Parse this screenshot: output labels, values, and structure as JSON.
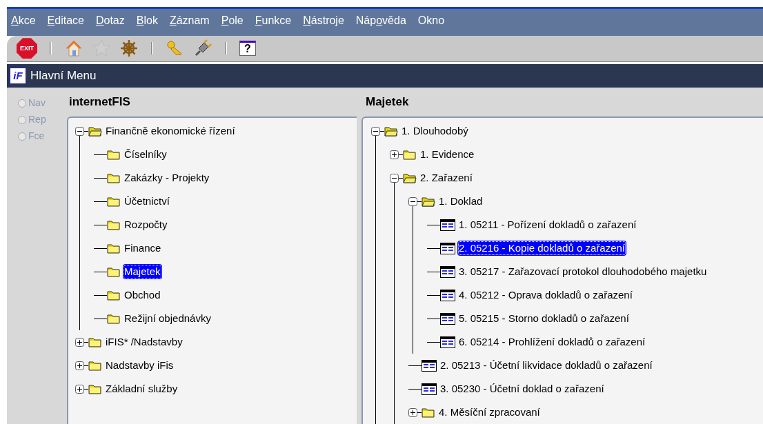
{
  "menu": [
    {
      "key": "A",
      "after": "kce"
    },
    {
      "key": "E",
      "after": "ditace"
    },
    {
      "key": "D",
      "after": "otaz"
    },
    {
      "key": "B",
      "after": "lok"
    },
    {
      "key": "Z",
      "after": "áznam"
    },
    {
      "key": "P",
      "after": "ole"
    },
    {
      "key": "F",
      "after": "unkce"
    },
    {
      "key": "N",
      "after": "ástroje"
    },
    {
      "before": "Náp",
      "key": "o",
      "after": "věda"
    },
    {
      "before": "Okno"
    }
  ],
  "toolbar": [
    {
      "kind": "exit",
      "text": "EXIT",
      "disabled": false
    },
    {
      "kind": "separator"
    },
    {
      "kind": "home",
      "disabled": false
    },
    {
      "kind": "star",
      "disabled": true
    },
    {
      "kind": "wheel",
      "disabled": false
    },
    {
      "kind": "separator"
    },
    {
      "kind": "key",
      "disabled": false
    },
    {
      "kind": "plug",
      "disabled": false
    },
    {
      "kind": "separator"
    },
    {
      "kind": "help",
      "text": "?",
      "disabled": false
    }
  ],
  "window": {
    "logo": "iF",
    "title": "Hlavní Menu"
  },
  "modes": [
    {
      "label": "Nav",
      "selected": false,
      "disabled": true
    },
    {
      "label": "Rep",
      "selected": false,
      "disabled": true
    },
    {
      "label": "Fce",
      "selected": false,
      "disabled": true
    }
  ],
  "left_tree": {
    "title": "internetFIS",
    "nodes": [
      {
        "label": "Finančně ekonomické řízení",
        "kind": "folder",
        "expanded": true,
        "selected": false,
        "children": [
          {
            "label": "Číselníky",
            "kind": "folder",
            "selected": false
          },
          {
            "label": "Zakázky - Projekty",
            "kind": "folder",
            "selected": false
          },
          {
            "label": "Účetnictví",
            "kind": "folder",
            "selected": false
          },
          {
            "label": "Rozpočty",
            "kind": "folder",
            "selected": false
          },
          {
            "label": "Finance",
            "kind": "folder",
            "selected": false
          },
          {
            "label": "Majetek",
            "kind": "folder",
            "selected": true
          },
          {
            "label": "Obchod",
            "kind": "folder",
            "selected": false
          },
          {
            "label": "Režijní objednávky",
            "kind": "folder",
            "selected": false
          }
        ]
      },
      {
        "label": "iFIS* /Nadstavby",
        "kind": "folder",
        "expanded": false,
        "selected": false
      },
      {
        "label": "Nadstavby iFis",
        "kind": "folder",
        "expanded": false,
        "selected": false
      },
      {
        "label": "Základní služby",
        "kind": "folder",
        "expanded": false,
        "selected": false
      }
    ]
  },
  "right_tree": {
    "title": "Majetek",
    "nodes": [
      {
        "label": "1.  Dlouhodobý",
        "kind": "folder",
        "expanded": true,
        "selected": false,
        "children": [
          {
            "label": "1.  Evidence",
            "kind": "folder",
            "expanded": false,
            "selected": false
          },
          {
            "label": "2.  Zařazení",
            "kind": "folder",
            "expanded": true,
            "selected": false,
            "children": [
              {
                "label": "1.  Doklad",
                "kind": "folder",
                "expanded": true,
                "selected": false,
                "children": [
                  {
                    "label": "1.  05211 - Pořízení dokladů o zařazení",
                    "kind": "form",
                    "selected": false
                  },
                  {
                    "label": "2.  05216 - Kopie dokladů o zařazení",
                    "kind": "form",
                    "selected": true
                  },
                  {
                    "label": "3.  05217 - Zařazovací protokol dlouhodobého majetku",
                    "kind": "form",
                    "selected": false
                  },
                  {
                    "label": "4.  05212 - Oprava dokladů o zařazení",
                    "kind": "form",
                    "selected": false
                  },
                  {
                    "label": "5.  05215 - Storno dokladů o zařazení",
                    "kind": "form",
                    "selected": false
                  },
                  {
                    "label": "6.  05214 - Prohlížení dokladů o zařazení",
                    "kind": "form",
                    "selected": false
                  }
                ]
              },
              {
                "label": "2.  05213 - Účetní likvidace dokladů o zařazení",
                "kind": "form",
                "selected": false
              },
              {
                "label": "3.  05230 - Účetní doklad o zařazení",
                "kind": "form",
                "selected": false
              },
              {
                "label": "4.  Měsíční zpracovaní",
                "kind": "folder",
                "expanded": false,
                "selected": false
              }
            ]
          }
        ]
      }
    ]
  }
}
